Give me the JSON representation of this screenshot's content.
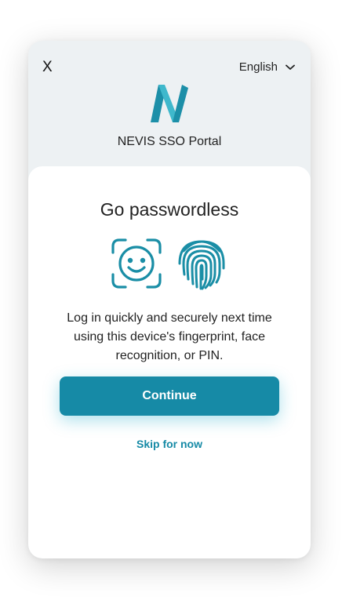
{
  "header": {
    "close_label": "X",
    "language": "English",
    "brand_name": "NEVIS SSO Portal"
  },
  "card": {
    "title": "Go passwordless",
    "description": "Log in quickly and securely next time using this device's fingerprint, face recognition, or PIN.",
    "continue_label": "Continue",
    "skip_label": "Skip for now"
  },
  "icons": {
    "close": "close-icon",
    "language_dropdown": "chevron-down-icon",
    "logo": "nevis-logo",
    "face": "face-recognition-icon",
    "fingerprint": "fingerprint-icon"
  },
  "colors": {
    "accent": "#168aa6",
    "header_background": "#edf1f3",
    "card_background": "#ffffff"
  }
}
